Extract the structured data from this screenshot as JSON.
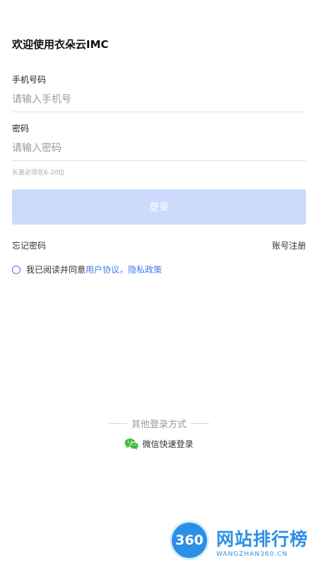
{
  "page": {
    "title": "欢迎使用衣朵云IMC"
  },
  "form": {
    "phone_label": "手机号码",
    "phone_placeholder": "请输入手机号",
    "password_label": "密码",
    "password_placeholder": "请输入密码",
    "password_hint": "长度必须在6-20位",
    "login_label": "登录"
  },
  "links": {
    "forgot_password": "忘记密码",
    "register": "账号注册"
  },
  "agreement": {
    "prefix": "我已阅读并同意",
    "user_agreement": "用户协议",
    "separator": "，",
    "privacy_policy": "隐私政策",
    "checked": false
  },
  "other_login": {
    "title": "其他登录方式",
    "wechat_label": "微信快速登录",
    "icon": "wechat-icon"
  },
  "watermark": {
    "badge": "360",
    "name": "网站排行榜",
    "subtitle": "WANGZHAN360.CN"
  },
  "colors": {
    "accent": "#3b7cf2",
    "button_disabled": "#ccdafc",
    "wechat_green": "#3fba3c",
    "watermark_blue": "#2c8fe6"
  }
}
